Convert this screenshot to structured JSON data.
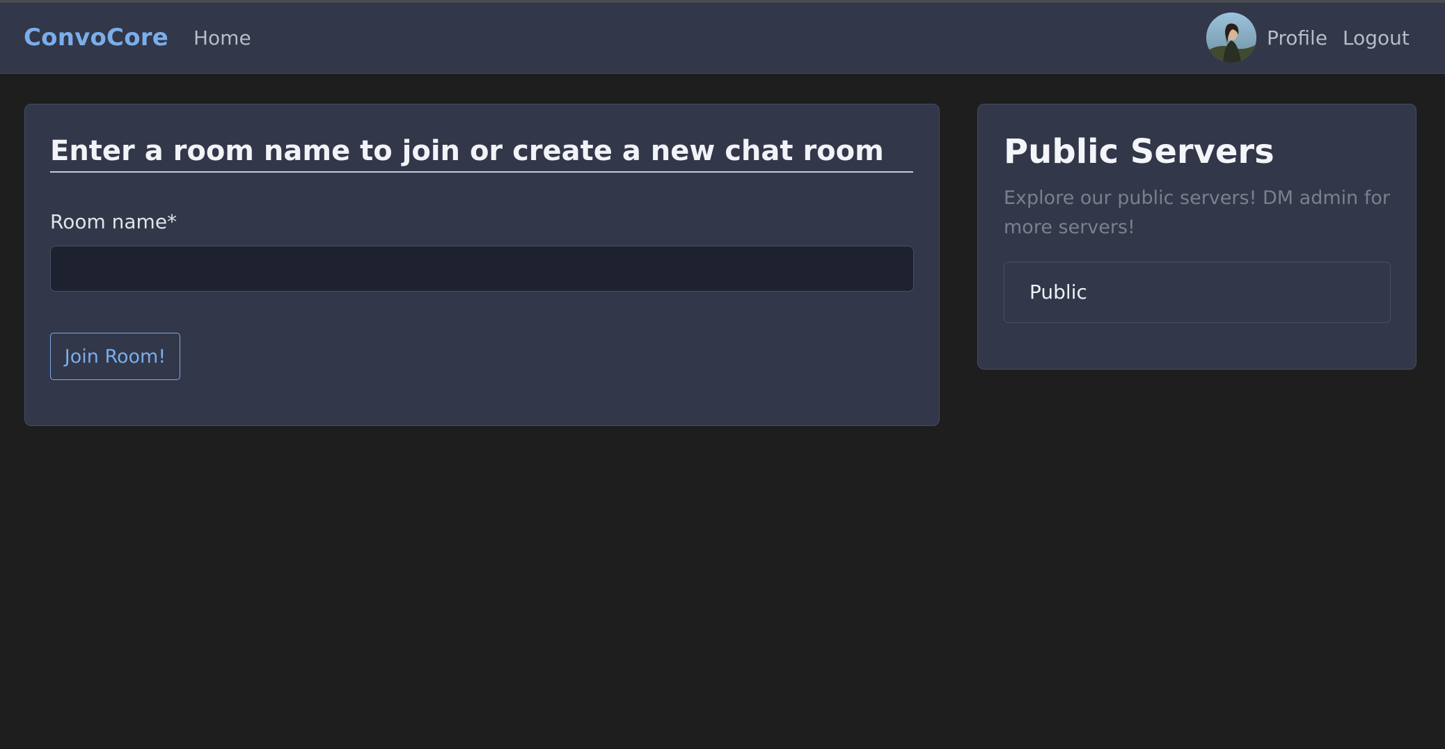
{
  "navbar": {
    "brand": "ConvoCore",
    "home_label": "Home",
    "profile_label": "Profile",
    "logout_label": "Logout"
  },
  "join_room": {
    "title": "Enter a room name to join or create a new chat room",
    "room_name_label": "Room name*",
    "room_name_value": "",
    "join_button_label": "Join Room!"
  },
  "public_servers": {
    "title": "Public Servers",
    "description": "Explore our public servers! DM admin for more servers!",
    "servers": [
      {
        "name": "Public"
      }
    ]
  },
  "colors": {
    "accent": "#7aaeeb",
    "navbar_bg": "#323749",
    "page_bg": "#1e1e1f"
  }
}
